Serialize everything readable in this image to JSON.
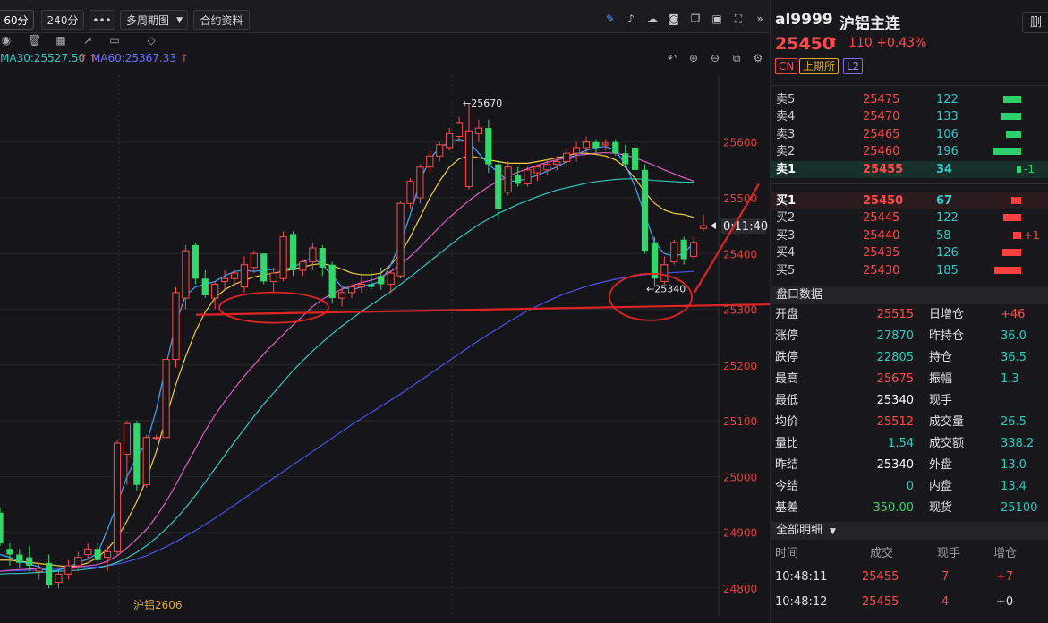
{
  "toolbar": {
    "period_60": "60分",
    "period_240": "240分",
    "more": "•••",
    "multi_period": "多周期图",
    "contract_info": "合约资料"
  },
  "ma": {
    "ma30": "MA30:25527.50",
    "ma60": "MA60:25367.33"
  },
  "chart": {
    "contract_label": "沪铝2606",
    "countdown": "0:11:40",
    "high_label": "←25670",
    "low_label": "←25340",
    "y_ticks": [
      "25600",
      "25500",
      "25400",
      "25300",
      "25200",
      "25100",
      "25000",
      "24900",
      "24800"
    ],
    "colors": {
      "up": "#ff4a4a",
      "down": "#33d66b",
      "ma5": "#3aa8ff",
      "ma10": "#f4d03f",
      "ma20": "#e05cc8",
      "ma30": "#2fc6c0",
      "ma60": "#4a52e8",
      "annot": "#e02424"
    }
  },
  "chart_data": {
    "type": "candlestick",
    "ylim": [
      24750,
      25720
    ],
    "candles": [
      {
        "o": 24935,
        "h": 24945,
        "l": 24875,
        "c": 24880
      },
      {
        "o": 24870,
        "h": 24880,
        "l": 24840,
        "c": 24860
      },
      {
        "o": 24860,
        "h": 24870,
        "l": 24835,
        "c": 24845
      },
      {
        "o": 24855,
        "h": 24875,
        "l": 24830,
        "c": 24840
      },
      {
        "o": 24830,
        "h": 24845,
        "l": 24815,
        "c": 24835
      },
      {
        "o": 24845,
        "h": 24860,
        "l": 24800,
        "c": 24805
      },
      {
        "o": 24810,
        "h": 24830,
        "l": 24800,
        "c": 24825
      },
      {
        "o": 24825,
        "h": 24850,
        "l": 24815,
        "c": 24840
      },
      {
        "o": 24840,
        "h": 24865,
        "l": 24830,
        "c": 24855
      },
      {
        "o": 24860,
        "h": 24880,
        "l": 24850,
        "c": 24870
      },
      {
        "o": 24870,
        "h": 24880,
        "l": 24845,
        "c": 24850
      },
      {
        "o": 24855,
        "h": 24875,
        "l": 24830,
        "c": 24865
      },
      {
        "o": 24865,
        "h": 25065,
        "l": 24860,
        "c": 25060
      },
      {
        "o": 25040,
        "h": 25100,
        "l": 24985,
        "c": 25095
      },
      {
        "o": 25095,
        "h": 25100,
        "l": 24975,
        "c": 24985
      },
      {
        "o": 24985,
        "h": 25075,
        "l": 24980,
        "c": 25070
      },
      {
        "o": 25070,
        "h": 25075,
        "l": 25065,
        "c": 25070
      },
      {
        "o": 25070,
        "h": 25215,
        "l": 25065,
        "c": 25210
      },
      {
        "o": 25210,
        "h": 25340,
        "l": 25195,
        "c": 25330
      },
      {
        "o": 25320,
        "h": 25415,
        "l": 25300,
        "c": 25405
      },
      {
        "o": 25415,
        "h": 25420,
        "l": 25345,
        "c": 25355
      },
      {
        "o": 25355,
        "h": 25370,
        "l": 25320,
        "c": 25325
      },
      {
        "o": 25320,
        "h": 25350,
        "l": 25300,
        "c": 25345
      },
      {
        "o": 25350,
        "h": 25370,
        "l": 25335,
        "c": 25355
      },
      {
        "o": 25355,
        "h": 25370,
        "l": 25340,
        "c": 25365
      },
      {
        "o": 25340,
        "h": 25395,
        "l": 25330,
        "c": 25380
      },
      {
        "o": 25375,
        "h": 25405,
        "l": 25365,
        "c": 25400
      },
      {
        "o": 25400,
        "h": 25400,
        "l": 25345,
        "c": 25350
      },
      {
        "o": 25350,
        "h": 25375,
        "l": 25330,
        "c": 25365
      },
      {
        "o": 25355,
        "h": 25440,
        "l": 25350,
        "c": 25430
      },
      {
        "o": 25435,
        "h": 25440,
        "l": 25360,
        "c": 25370
      },
      {
        "o": 25370,
        "h": 25390,
        "l": 25360,
        "c": 25385
      },
      {
        "o": 25385,
        "h": 25420,
        "l": 25370,
        "c": 25410
      },
      {
        "o": 25410,
        "h": 25415,
        "l": 25360,
        "c": 25375
      },
      {
        "o": 25380,
        "h": 25385,
        "l": 25310,
        "c": 25320
      },
      {
        "o": 25320,
        "h": 25340,
        "l": 25305,
        "c": 25330
      },
      {
        "o": 25330,
        "h": 25345,
        "l": 25320,
        "c": 25340
      },
      {
        "o": 25340,
        "h": 25360,
        "l": 25330,
        "c": 25345
      },
      {
        "o": 25345,
        "h": 25370,
        "l": 25335,
        "c": 25340
      },
      {
        "o": 25360,
        "h": 25375,
        "l": 25335,
        "c": 25345
      },
      {
        "o": 25345,
        "h": 25370,
        "l": 25330,
        "c": 25365
      },
      {
        "o": 25360,
        "h": 25495,
        "l": 25355,
        "c": 25490
      },
      {
        "o": 25490,
        "h": 25535,
        "l": 25480,
        "c": 25530
      },
      {
        "o": 25500,
        "h": 25560,
        "l": 25490,
        "c": 25555
      },
      {
        "o": 25555,
        "h": 25585,
        "l": 25545,
        "c": 25575
      },
      {
        "o": 25575,
        "h": 25600,
        "l": 25565,
        "c": 25595
      },
      {
        "o": 25590,
        "h": 25625,
        "l": 25585,
        "c": 25615
      },
      {
        "o": 25610,
        "h": 25645,
        "l": 25600,
        "c": 25635
      },
      {
        "o": 25520,
        "h": 25670,
        "l": 25515,
        "c": 25620
      },
      {
        "o": 25615,
        "h": 25640,
        "l": 25600,
        "c": 25625
      },
      {
        "o": 25625,
        "h": 25640,
        "l": 25545,
        "c": 25560
      },
      {
        "o": 25560,
        "h": 25570,
        "l": 25460,
        "c": 25480
      },
      {
        "o": 25510,
        "h": 25565,
        "l": 25505,
        "c": 25555
      },
      {
        "o": 25540,
        "h": 25555,
        "l": 25520,
        "c": 25525
      },
      {
        "o": 25525,
        "h": 25555,
        "l": 25520,
        "c": 25550
      },
      {
        "o": 25545,
        "h": 25560,
        "l": 25530,
        "c": 25555
      },
      {
        "o": 25550,
        "h": 25570,
        "l": 25540,
        "c": 25560
      },
      {
        "o": 25560,
        "h": 25575,
        "l": 25550,
        "c": 25565
      },
      {
        "o": 25565,
        "h": 25590,
        "l": 25555,
        "c": 25580
      },
      {
        "o": 25580,
        "h": 25600,
        "l": 25565,
        "c": 25590
      },
      {
        "o": 25590,
        "h": 25610,
        "l": 25580,
        "c": 25600
      },
      {
        "o": 25600,
        "h": 25605,
        "l": 25580,
        "c": 25590
      },
      {
        "o": 25595,
        "h": 25605,
        "l": 25585,
        "c": 25598
      },
      {
        "o": 25600,
        "h": 25605,
        "l": 25575,
        "c": 25580
      },
      {
        "o": 25580,
        "h": 25595,
        "l": 25555,
        "c": 25560
      },
      {
        "o": 25590,
        "h": 25600,
        "l": 25545,
        "c": 25550
      },
      {
        "o": 25550,
        "h": 25560,
        "l": 25400,
        "c": 25405
      },
      {
        "o": 25420,
        "h": 25430,
        "l": 25340,
        "c": 25355
      },
      {
        "o": 25350,
        "h": 25395,
        "l": 25345,
        "c": 25380
      },
      {
        "o": 25385,
        "h": 25425,
        "l": 25380,
        "c": 25420
      },
      {
        "o": 25425,
        "h": 25430,
        "l": 25380,
        "c": 25390
      },
      {
        "o": 25395,
        "h": 25430,
        "l": 25390,
        "c": 25420
      },
      {
        "o": 25445,
        "h": 25470,
        "l": 25440,
        "c": 25450
      }
    ],
    "ma_series": {
      "ma5": [
        24860,
        24855,
        24848,
        24843,
        24838,
        24830,
        24832,
        24838,
        24845,
        24852,
        24862,
        24905,
        24950,
        25000,
        25035,
        25060,
        25120,
        25200,
        25275,
        25325,
        25340,
        25345,
        25350,
        25360,
        25368,
        25370,
        25368,
        25370,
        25372,
        25372,
        25375,
        25385,
        25392,
        25380,
        25360,
        25340,
        25335,
        25340,
        25345,
        25350,
        25380,
        25420,
        25470,
        25530,
        25570,
        25590,
        25600,
        25605,
        25600,
        25580,
        25560,
        25545,
        25530,
        25530,
        25535,
        25540,
        25548,
        25555,
        25565,
        25578,
        25585,
        25590,
        25592,
        25585,
        25560,
        25520,
        25470,
        25420,
        25400,
        25395,
        25400,
        25420
      ],
      "ma10": [
        24850,
        24850,
        24848,
        24846,
        24844,
        24842,
        24840,
        24838,
        24840,
        24845,
        24855,
        24870,
        24890,
        24920,
        24955,
        24995,
        25045,
        25105,
        25165,
        25215,
        25260,
        25295,
        25320,
        25335,
        25345,
        25352,
        25358,
        25362,
        25365,
        25368,
        25372,
        25376,
        25380,
        25382,
        25378,
        25372,
        25365,
        25362,
        25362,
        25365,
        25380,
        25400,
        25430,
        25465,
        25500,
        25530,
        25555,
        25570,
        25575,
        25572,
        25568,
        25565,
        25562,
        25562,
        25562,
        25565,
        25568,
        25572,
        25575,
        25580,
        25580,
        25578,
        25575,
        25568,
        25555,
        25535,
        25510,
        25490,
        25478,
        25472,
        25470,
        25465
      ],
      "ma20": [
        24830,
        24832,
        24833,
        24834,
        24835,
        24836,
        24836,
        24837,
        24838,
        24840,
        24842,
        24848,
        24858,
        24872,
        24888,
        24905,
        24928,
        24955,
        24985,
        25018,
        25050,
        25082,
        25110,
        25135,
        25158,
        25180,
        25200,
        25220,
        25238,
        25255,
        25272,
        25288,
        25305,
        25318,
        25328,
        25336,
        25342,
        25348,
        25352,
        25358,
        25368,
        25380,
        25395,
        25412,
        25430,
        25448,
        25465,
        25480,
        25495,
        25508,
        25520,
        25530,
        25538,
        25546,
        25552,
        25558,
        25564,
        25568,
        25572,
        25576,
        25578,
        25580,
        25581,
        25580,
        25577,
        25572,
        25565,
        25558,
        25550,
        25543,
        25536,
        25530
      ],
      "ma30": [
        24825,
        24826,
        24826,
        24827,
        24828,
        24829,
        24830,
        24831,
        24832,
        24834,
        24836,
        24840,
        24846,
        24854,
        24864,
        24876,
        24890,
        24906,
        24924,
        24944,
        24966,
        24990,
        25014,
        25038,
        25062,
        25085,
        25108,
        25130,
        25150,
        25170,
        25190,
        25208,
        25225,
        25241,
        25256,
        25270,
        25283,
        25296,
        25308,
        25320,
        25332,
        25345,
        25358,
        25372,
        25386,
        25400,
        25414,
        25428,
        25440,
        25452,
        25462,
        25472,
        25480,
        25488,
        25495,
        25502,
        25508,
        25514,
        25518,
        25522,
        25526,
        25529,
        25531,
        25533,
        25534,
        25534,
        25533,
        25531,
        25530,
        25529,
        25528,
        25528
      ],
      "ma60": [
        24830,
        24831,
        24831,
        24832,
        24832,
        24833,
        24834,
        24835,
        24836,
        24837,
        24838,
        24840,
        24843,
        24847,
        24852,
        24858,
        24866,
        24874,
        24883,
        24893,
        24903,
        24914,
        24925,
        24937,
        24949,
        24961,
        24973,
        24985,
        24997,
        25009,
        25021,
        25033,
        25045,
        25057,
        25069,
        25081,
        25093,
        25104,
        25115,
        25126,
        25137,
        25148,
        25160,
        25172,
        25184,
        25196,
        25208,
        25220,
        25232,
        25244,
        25255,
        25266,
        25277,
        25287,
        25297,
        25306,
        25314,
        25322,
        25329,
        25335,
        25341,
        25346,
        25350,
        25354,
        25357,
        25360,
        25362,
        25364,
        25365,
        25366,
        25367,
        25368
      ]
    }
  },
  "right_panel": {
    "symbol": "al9999",
    "name": "沪铝主连",
    "delete_btn": "删",
    "price": "25450",
    "change": "110",
    "change_pct": "+0.43%",
    "tags": [
      "CN",
      "上期所",
      "L2"
    ],
    "asks": [
      {
        "label": "卖5",
        "price": "25475",
        "vol": "122",
        "bar": 0.55,
        "delta": ""
      },
      {
        "label": "卖4",
        "price": "25470",
        "vol": "133",
        "bar": 0.6,
        "delta": ""
      },
      {
        "label": "卖3",
        "price": "25465",
        "vol": "106",
        "bar": 0.48,
        "delta": ""
      },
      {
        "label": "卖2",
        "price": "25460",
        "vol": "196",
        "bar": 0.9,
        "delta": ""
      },
      {
        "label": "卖1",
        "price": "25455",
        "vol": "34",
        "bar": 0.15,
        "delta": "-1"
      }
    ],
    "bids": [
      {
        "label": "买1",
        "price": "25450",
        "vol": "67",
        "bar": 0.3,
        "delta": ""
      },
      {
        "label": "买2",
        "price": "25445",
        "vol": "122",
        "bar": 0.55,
        "delta": ""
      },
      {
        "label": "买3",
        "price": "25440",
        "vol": "58",
        "bar": 0.25,
        "delta": "+1"
      },
      {
        "label": "买4",
        "price": "25435",
        "vol": "126",
        "bar": 0.57,
        "delta": ""
      },
      {
        "label": "买5",
        "price": "25430",
        "vol": "185",
        "bar": 0.84,
        "delta": ""
      }
    ],
    "pankou_title": "盘口数据",
    "pankou": [
      [
        "开盘",
        "25515",
        "日增仓",
        "+46"
      ],
      [
        "涨停",
        "27870",
        "昨持仓",
        "36.0"
      ],
      [
        "跌停",
        "22805",
        "持仓",
        "36.5"
      ],
      [
        "最高",
        "25675",
        "振幅",
        "1.3"
      ],
      [
        "最低",
        "25340",
        "现手",
        ""
      ],
      [
        "均价",
        "25512",
        "成交量",
        "26.5"
      ],
      [
        "量比",
        "1.54",
        "成交额",
        "338.2"
      ],
      [
        "昨结",
        "25340",
        "外盘",
        "13.0"
      ],
      [
        "今结",
        "0",
        "内盘",
        "13.4"
      ],
      [
        "基差",
        "-350.00",
        "现货",
        "25100"
      ]
    ],
    "detail_title": "全部明细",
    "detail_headers": [
      "时间",
      "成交",
      "现手",
      "增仓"
    ],
    "details": [
      [
        "10:48:11",
        "25455",
        "7",
        "+7"
      ],
      [
        "10:48:12",
        "25455",
        "4",
        "+0"
      ]
    ]
  }
}
